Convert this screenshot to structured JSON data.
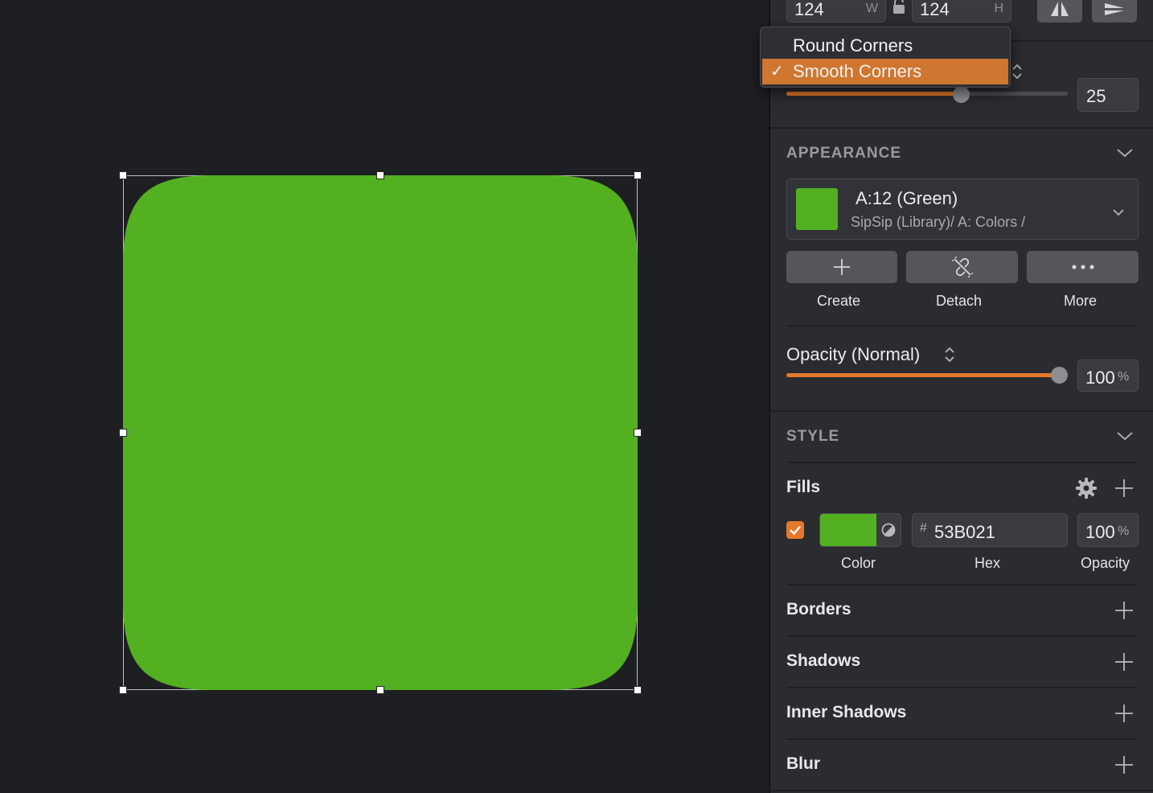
{
  "canvas": {
    "shape_color": "#53B021"
  },
  "dimensions": {
    "width_value": "124",
    "width_suffix": "W",
    "height_value": "124",
    "height_suffix": "H"
  },
  "corner_menu": {
    "items": [
      {
        "label": "Round Corners",
        "selected": false
      },
      {
        "label": "Smooth Corners",
        "selected": true
      }
    ],
    "checkmark": "✓"
  },
  "radius": {
    "value": "25",
    "slider_fraction": 0.63
  },
  "appearance": {
    "section_title": "APPEARANCE",
    "swatch_color": "#53B021",
    "style_name": "A:12 (Green)",
    "style_path": "SipSip (Library)/ A: Colors /",
    "buttons": [
      {
        "label": "Create",
        "icon": "plus-icon"
      },
      {
        "label": "Detach",
        "icon": "unlink-icon"
      },
      {
        "label": "More",
        "icon": "more-dots-icon"
      }
    ],
    "opacity_label": "Opacity (Normal)",
    "opacity_value": "100",
    "opacity_unit": "%",
    "opacity_fraction": 1.0
  },
  "style": {
    "section_title": "STYLE",
    "fills_title": "Fills",
    "fill": {
      "enabled": true,
      "color": "#53B021",
      "hex_prefix": "#",
      "hex_value": "53B021",
      "opacity_value": "100",
      "opacity_unit": "%",
      "color_label": "Color",
      "hex_label": "Hex",
      "opacity_label": "Opacity"
    },
    "rows": [
      "Borders",
      "Shadows",
      "Inner Shadows",
      "Blur"
    ]
  },
  "colors": {
    "accent": "#E4782B",
    "panel": "#2B2C30",
    "canvas": "#1E1F22"
  }
}
